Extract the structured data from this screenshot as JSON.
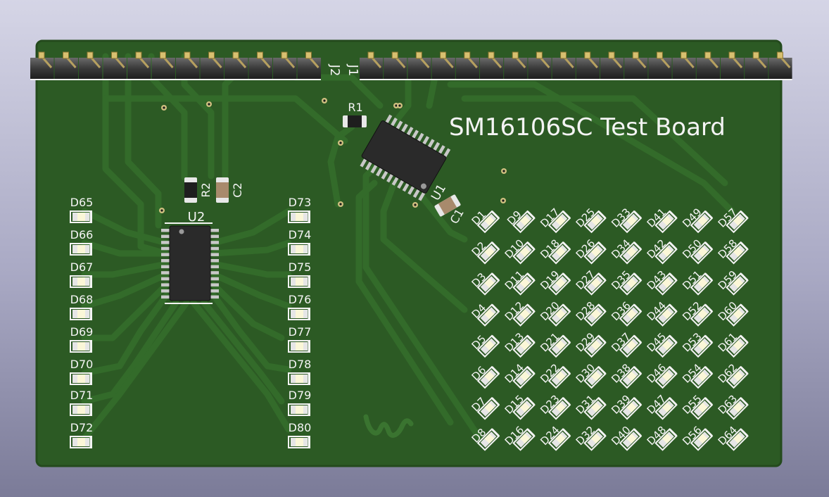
{
  "board": {
    "title": "SM16106SC Test Board",
    "colors": {
      "background_top": "#d5d5e6",
      "background_bottom": "#7b7b98",
      "soldermask": "#2c5a24",
      "trace": "#336b2a",
      "silkscreen": "#f4f4f4",
      "pins": "#d8c070"
    }
  },
  "connectors": [
    {
      "ref": "J2",
      "pins": 12
    },
    {
      "ref": "J1",
      "pins": 18
    }
  ],
  "chips": [
    {
      "ref": "U1",
      "package": "TSSOP-24",
      "rotation": "30"
    },
    {
      "ref": "U2",
      "package": "TSSOP-24",
      "rotation": "0"
    }
  ],
  "passives": [
    {
      "ref": "R1",
      "kind": "resistor"
    },
    {
      "ref": "R2",
      "kind": "resistor"
    },
    {
      "ref": "C1",
      "kind": "capacitor"
    },
    {
      "ref": "C2",
      "kind": "capacitor"
    }
  ],
  "led_grid": {
    "columns": 8,
    "rows": 8,
    "labels": [
      "D1",
      "D2",
      "D3",
      "D4",
      "D5",
      "D6",
      "D7",
      "D8",
      "D9",
      "D10",
      "D11",
      "D12",
      "D13",
      "D14",
      "D15",
      "D16",
      "D17",
      "D18",
      "D19",
      "D20",
      "D21",
      "D22",
      "D23",
      "D24",
      "D25",
      "D26",
      "D27",
      "D28",
      "D29",
      "D30",
      "D31",
      "D32",
      "D33",
      "D34",
      "D35",
      "D36",
      "D37",
      "D38",
      "D39",
      "D40",
      "D41",
      "D42",
      "D43",
      "D44",
      "D45",
      "D46",
      "D47",
      "D48",
      "D49",
      "D50",
      "D51",
      "D52",
      "D53",
      "D54",
      "D55",
      "D56",
      "D57",
      "D58",
      "D59",
      "D60",
      "D61",
      "D62",
      "D63",
      "D64"
    ]
  },
  "led_left": [
    "D65",
    "D66",
    "D67",
    "D68",
    "D69",
    "D70",
    "D71",
    "D72"
  ],
  "led_right": [
    "D73",
    "D74",
    "D75",
    "D76",
    "D77",
    "D78",
    "D79",
    "D80"
  ]
}
